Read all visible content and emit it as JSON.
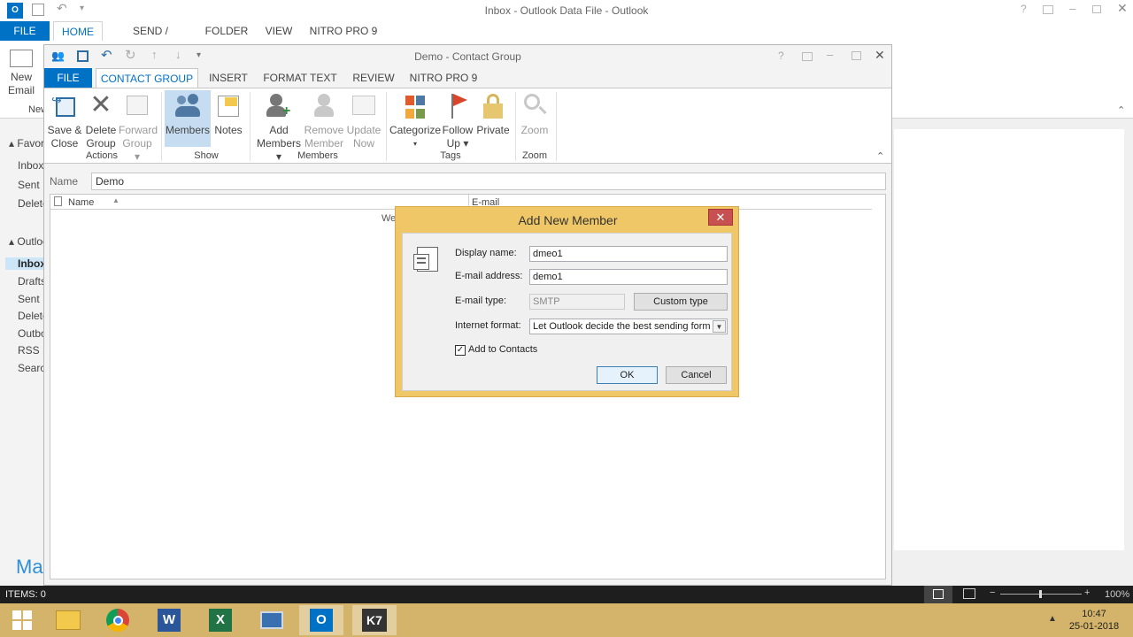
{
  "outlook": {
    "title": "Inbox - Outlook Data File - Outlook",
    "tabs": [
      "FILE",
      "HOME",
      "SEND / RECEIVE",
      "FOLDER",
      "VIEW",
      "NITRO PRO 9"
    ],
    "ribbon": {
      "new_email_line1": "New",
      "new_email_line2": "Email",
      "group_new": "New"
    },
    "nav": {
      "favorites": "Favorites",
      "fav_items": [
        "Inbox",
        "Sent Items",
        "Deleted Items"
      ],
      "outlook_data": "Outlook Data File",
      "items": [
        "Inbox",
        "Drafts",
        "Sent Items",
        "Deleted Items",
        "Outbox",
        "RSS Feeds",
        "Search Folders"
      ]
    },
    "mail_label": "Ma",
    "status": {
      "items": "ITEMS: 0",
      "zoom": "100%"
    }
  },
  "contact_group": {
    "title": "Demo - Contact Group",
    "tabs": [
      "FILE",
      "CONTACT GROUP",
      "INSERT",
      "FORMAT TEXT",
      "REVIEW",
      "NITRO PRO 9"
    ],
    "buttons": {
      "save_close": [
        "Save &",
        "Close"
      ],
      "delete_group": [
        "Delete",
        "Group"
      ],
      "forward_group": [
        "Forward",
        "Group"
      ],
      "members": "Members",
      "notes": "Notes",
      "add_members": [
        "Add",
        "Members"
      ],
      "remove_member": [
        "Remove",
        "Member"
      ],
      "update_now": [
        "Update",
        "Now"
      ],
      "categorize": "Categorize",
      "follow_up": [
        "Follow",
        "Up"
      ],
      "private": "Private",
      "zoom": "Zoom"
    },
    "groups": {
      "actions": "Actions",
      "show": "Show",
      "members": "Members",
      "tags": "Tags",
      "zoom": "Zoom"
    },
    "name_label": "Name",
    "name_value": "Demo",
    "columns": {
      "name": "Name",
      "email": "E-mail"
    },
    "list_hint": "We"
  },
  "dialog": {
    "title": "Add New Member",
    "display_name_label": "Display name:",
    "display_name_value": "dmeo1",
    "email_label": "E-mail address:",
    "email_value": "demo1",
    "email_type_label": "E-mail type:",
    "email_type_value": "SMTP",
    "custom_type": "Custom type",
    "internet_format_label": "Internet format:",
    "internet_format_value": "Let Outlook decide the best sending form",
    "add_to_contacts": "Add to Contacts",
    "add_to_contacts_checked": true,
    "ok": "OK",
    "cancel": "Cancel"
  },
  "taskbar": {
    "time": "10:47",
    "date": "25-01-2018"
  },
  "colors": {
    "accent": "#0072c6",
    "taskbar": "#d3b46a",
    "dialog_frame": "#f0c766",
    "close_red": "#c75050"
  }
}
